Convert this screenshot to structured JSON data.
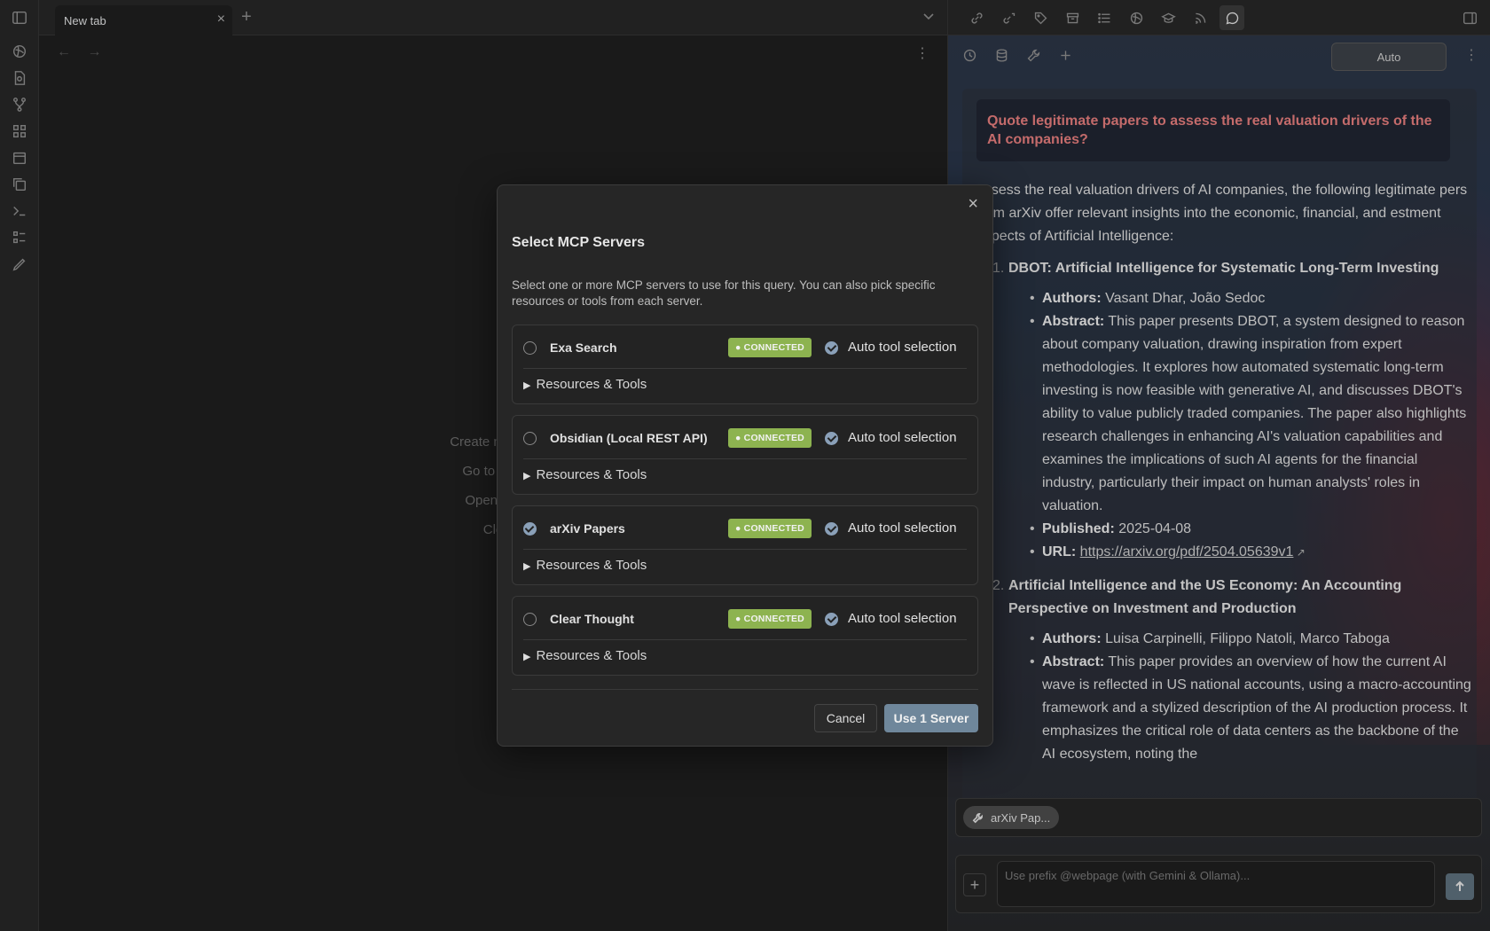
{
  "tabbar": {
    "tab_title": "New tab"
  },
  "editor": {
    "empty_actions": [
      "Create new no",
      "Go to file (",
      "Open wel",
      "Clo"
    ]
  },
  "chat": {
    "mode_label": "Auto",
    "query": "Quote legitimate papers to assess the real valuation drivers of the AI companies?",
    "intro": "assess the real valuation drivers of AI companies, the following legitimate pers from arXiv offer relevant insights into the economic, financial, and estment aspects of Artificial Intelligence:",
    "papers": [
      {
        "num": "1.",
        "title": "DBOT: Artificial Intelligence for Systematic Long-Term Investing",
        "authors_label": "Authors:",
        "authors": "Vasant Dhar, João Sedoc",
        "abstract_label": "Abstract:",
        "abstract": "This paper presents DBOT, a system designed to reason about company valuation, drawing inspiration from expert methodologies. It explores how automated systematic long-term investing is now feasible with generative AI, and discusses DBOT's ability to value publicly traded companies. The paper also highlights research challenges in enhancing AI's valuation capabilities and examines the implications of such AI agents for the financial industry, particularly their impact on human analysts' roles in valuation.",
        "published_label": "Published:",
        "published": "2025-04-08",
        "url_label": "URL:",
        "url": "https://arxiv.org/pdf/2504.05639v1"
      },
      {
        "num": "2.",
        "title": "Artificial Intelligence and the US Economy: An Accounting Perspective on Investment and Production",
        "authors_label": "Authors:",
        "authors": "Luisa Carpinelli, Filippo Natoli, Marco Taboga",
        "abstract_label": "Abstract:",
        "abstract": "This paper provides an overview of how the current AI wave is reflected in US national accounts, using a macro-accounting framework and a stylized description of the AI production process. It emphasizes the critical role of data centers as the backbone of the AI ecosystem, noting the"
      }
    ],
    "chip_label": "arXiv Pap...",
    "input_placeholder": "Use prefix @webpage (with Gemini & Ollama)..."
  },
  "modal": {
    "title": "Select MCP Servers",
    "description": "Select one or more MCP servers to use for this query. You can also pick specific resources or tools from each server.",
    "servers": [
      {
        "name": "Exa Search",
        "status": "● CONNECTED",
        "selected": false,
        "auto_label": "Auto tool selection",
        "expander": "Resources & Tools"
      },
      {
        "name": "Obsidian (Local REST API)",
        "status": "● CONNECTED",
        "selected": false,
        "auto_label": "Auto tool selection",
        "expander": "Resources & Tools"
      },
      {
        "name": "arXiv Papers",
        "status": "● CONNECTED",
        "selected": true,
        "auto_label": "Auto tool selection",
        "expander": "Resources & Tools"
      },
      {
        "name": "Clear Thought",
        "status": "● CONNECTED",
        "selected": false,
        "auto_label": "Auto tool selection",
        "expander": "Resources & Tools"
      }
    ],
    "cancel_label": "Cancel",
    "confirm_label": "Use 1 Server"
  },
  "colors": {
    "connected": "#8db350",
    "accent": "#6f879b",
    "query_text": "#e07a7a"
  }
}
